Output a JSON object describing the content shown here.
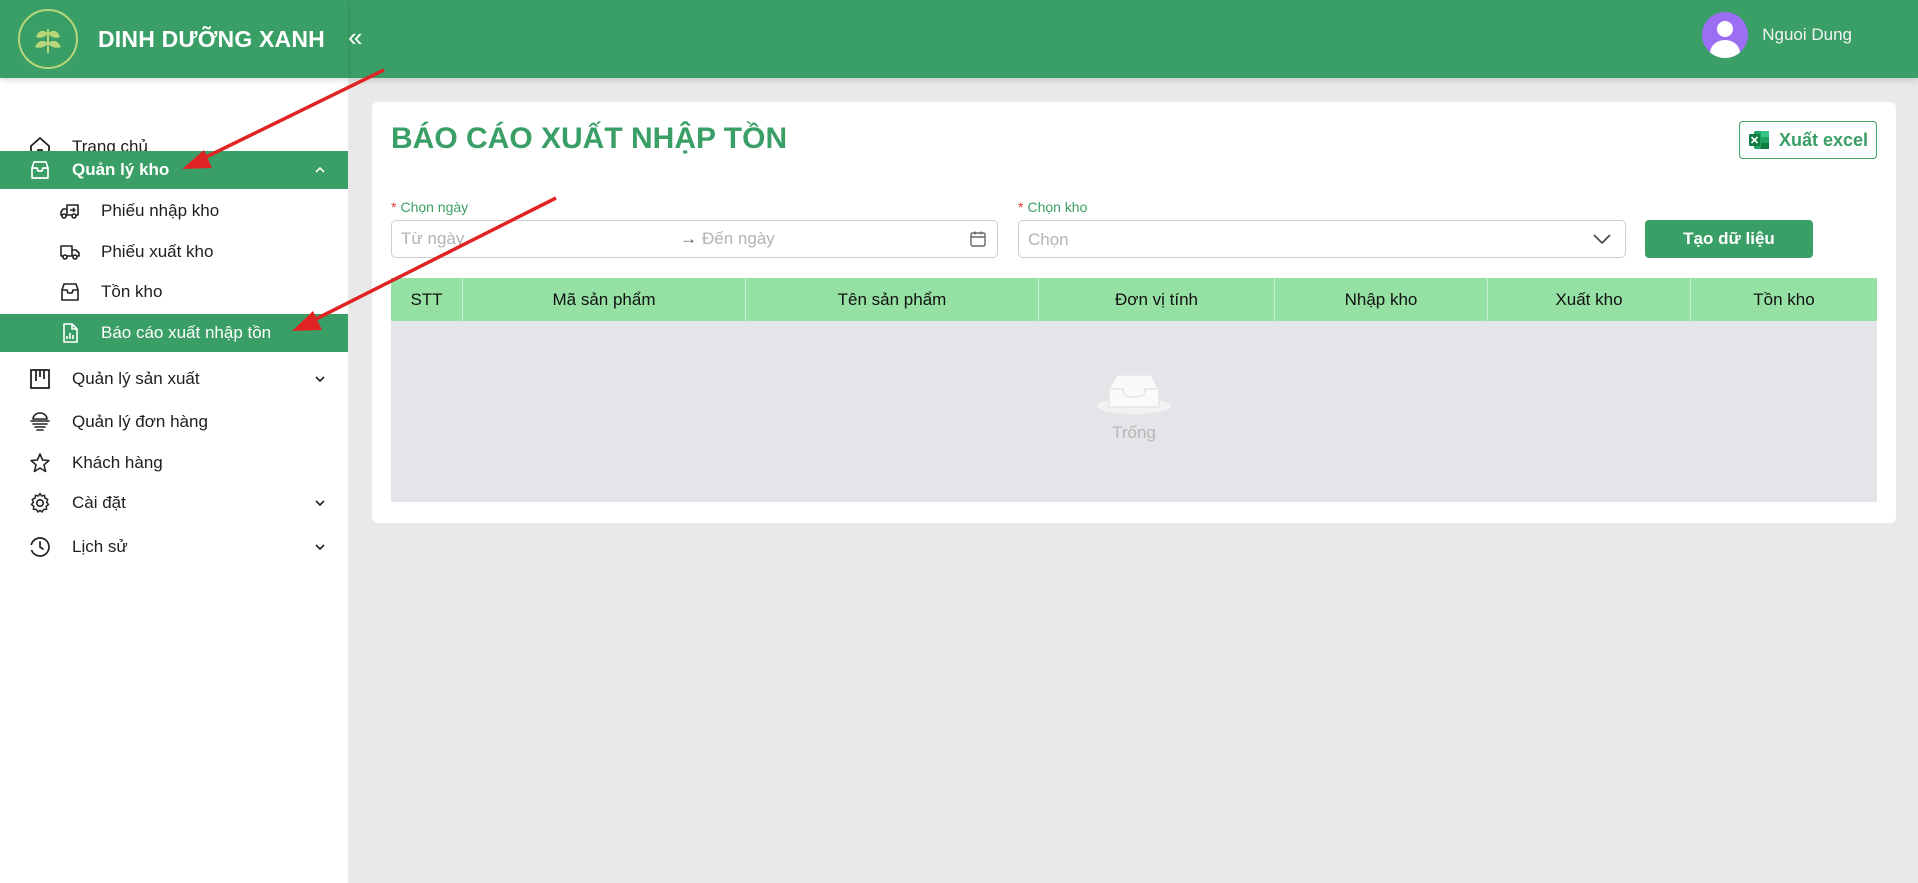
{
  "brand": {
    "name": "DINH DƯỠNG XANH",
    "logo_icon": "leaf-logo-icon"
  },
  "header": {
    "collapse_icon": "double-chevron-left-icon",
    "collapse_glyph": "«",
    "user_name": "Nguoi Dung"
  },
  "sidebar": {
    "items": [
      {
        "label": "Trang chủ",
        "icon": "home-icon"
      },
      {
        "label": "Quản lý kho",
        "icon": "inbox-icon",
        "expanded": true,
        "children": [
          {
            "label": "Phiếu nhập kho",
            "icon": "truck-in-icon"
          },
          {
            "label": "Phiếu xuất kho",
            "icon": "truck-icon"
          },
          {
            "label": "Tồn kho",
            "icon": "inbox-icon"
          },
          {
            "label": "Báo cáo xuất nhập tồn",
            "icon": "report-icon",
            "active": true
          }
        ]
      },
      {
        "label": "Quản lý sản xuất",
        "icon": "factory-icon",
        "has_children": true
      },
      {
        "label": "Quản lý đơn hàng",
        "icon": "orders-icon"
      },
      {
        "label": "Khách hàng",
        "icon": "star-icon"
      },
      {
        "label": "Cài đặt",
        "icon": "gear-icon",
        "has_children": true
      },
      {
        "label": "Lịch sử",
        "icon": "history-icon",
        "has_children": true
      }
    ]
  },
  "main": {
    "title": "BÁO CÁO XUẤT NHẬP TỒN",
    "export_label": "Xuất excel",
    "date_field": {
      "label": "Chọn ngày",
      "from_placeholder": "Từ ngày",
      "separator": "→",
      "to_placeholder": "Đến ngày"
    },
    "warehouse_field": {
      "label": "Chọn kho",
      "placeholder": "Chọn"
    },
    "required_mark": "*",
    "create_label": "Tạo dữ liệu",
    "table": {
      "columns": [
        "STT",
        "Mã sản phẩm",
        "Tên sản phẩm",
        "Đơn vị tính",
        "Nhập kho",
        "Xuất kho",
        "Tồn kho"
      ],
      "empty_text": "Trống"
    }
  },
  "colors": {
    "brand": "#3a9f66",
    "table_header": "#95e1a4",
    "annotation": "#e02424",
    "required": "#e23b3b"
  }
}
